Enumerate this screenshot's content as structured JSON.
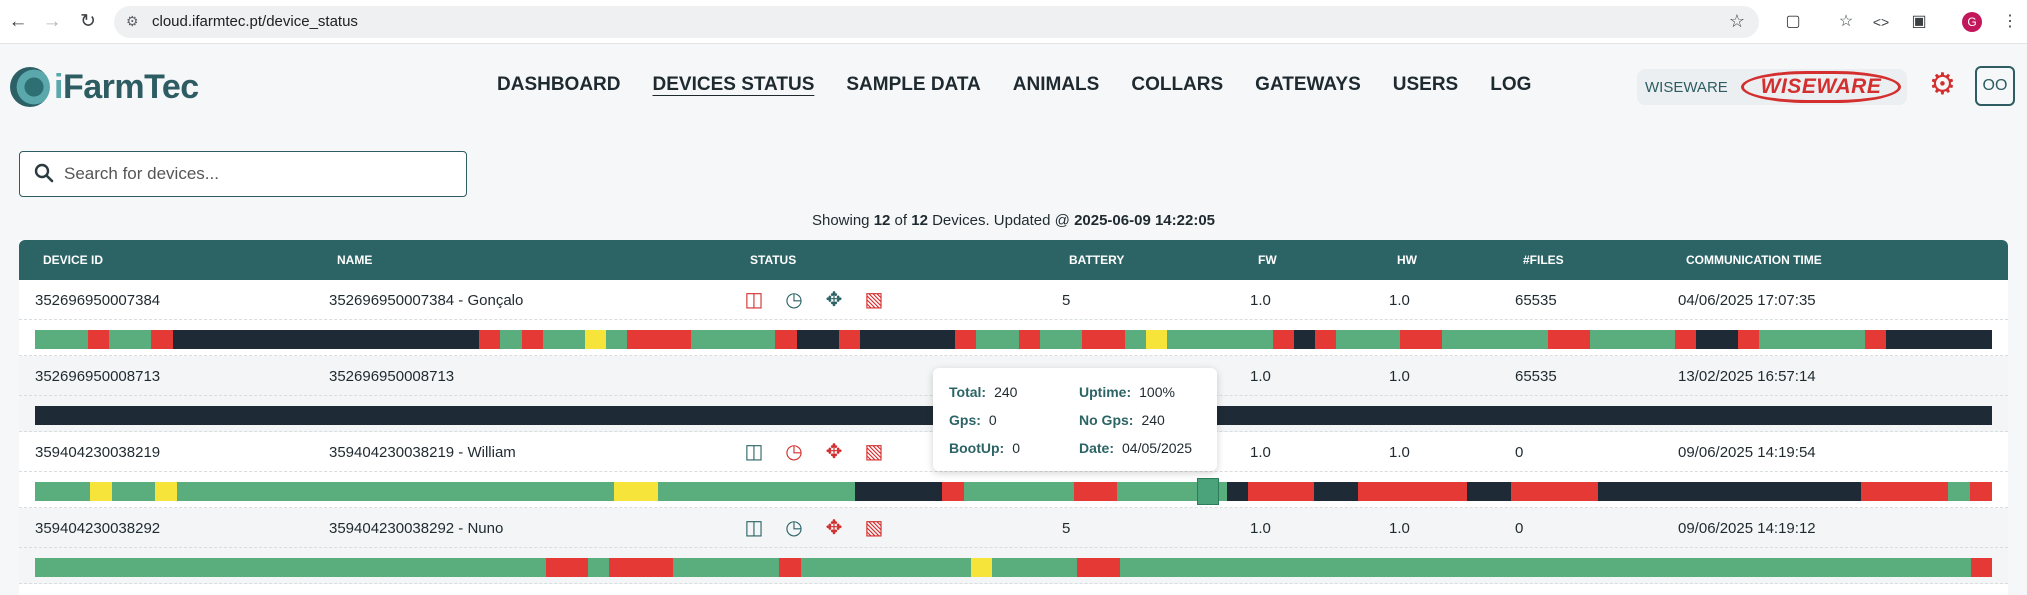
{
  "browser": {
    "url": "cloud.ifarmtec.pt/device_status",
    "profile_initial": "G"
  },
  "header": {
    "logo_prefix": "i",
    "logo_text": "FarmTec",
    "nav": [
      {
        "label": "DASHBOARD"
      },
      {
        "label": "DEVICES STATUS"
      },
      {
        "label": "SAMPLE DATA"
      },
      {
        "label": "ANIMALS"
      },
      {
        "label": "COLLARS"
      },
      {
        "label": "GATEWAYS"
      },
      {
        "label": "USERS"
      },
      {
        "label": "LOG"
      }
    ],
    "org_label": "WISEWARE",
    "org_logo_text": "WISEWARE",
    "user_initials": "OO"
  },
  "search": {
    "placeholder": "Search for devices..."
  },
  "summary": {
    "prefix": "Showing",
    "shown": "12",
    "of": "of",
    "total": "12",
    "suffix": "Devices. Updated @",
    "updated": "2025-06-09 14:22:05"
  },
  "table": {
    "columns": [
      "DEVICE ID",
      "NAME",
      "STATUS",
      "BATTERY",
      "FW",
      "HW",
      "#FILES",
      "COMMUNICATION TIME"
    ],
    "rows": [
      {
        "device_id": "352696950007384",
        "name": "352696950007384 - Gonçalo",
        "battery": "5",
        "fw": "1.0",
        "hw": "1.0",
        "files": "65535",
        "comm_time": "04/06/2025 17:07:35",
        "sd_icon_color": "red",
        "clock_icon_color": "teal"
      },
      {
        "device_id": "352696950008713",
        "name": "352696950008713",
        "battery": "",
        "fw": "1.0",
        "hw": "1.0",
        "files": "65535",
        "comm_time": "13/02/2025 16:57:14",
        "sd_icon_color": "",
        "clock_icon_color": ""
      },
      {
        "device_id": "359404230038219",
        "name": "359404230038219 - William",
        "battery": "",
        "fw": "1.0",
        "hw": "1.0",
        "files": "0",
        "comm_time": "09/06/2025 14:19:54",
        "sd_icon_color": "teal",
        "clock_icon_color": "red"
      },
      {
        "device_id": "359404230038292",
        "name": "359404230038292 - Nuno",
        "battery": "5",
        "fw": "1.0",
        "hw": "1.0",
        "files": "0",
        "comm_time": "09/06/2025 14:19:12",
        "sd_icon_color": "teal",
        "clock_icon_color": "teal"
      }
    ],
    "status_bar_colors": {
      "ok": "#5aae7e",
      "error": "#e53935",
      "warn": "#f7e43a",
      "offline": "#1e2a35"
    }
  },
  "tooltip": {
    "total_label": "Total:",
    "total": "240",
    "uptime_label": "Uptime:",
    "uptime": "100%",
    "gps_label": "Gps:",
    "gps": "0",
    "nogps_label": "No Gps:",
    "nogps": "240",
    "bootup_label": "BootUp:",
    "bootup": "0",
    "date_label": "Date:",
    "date": "04/05/2025"
  }
}
